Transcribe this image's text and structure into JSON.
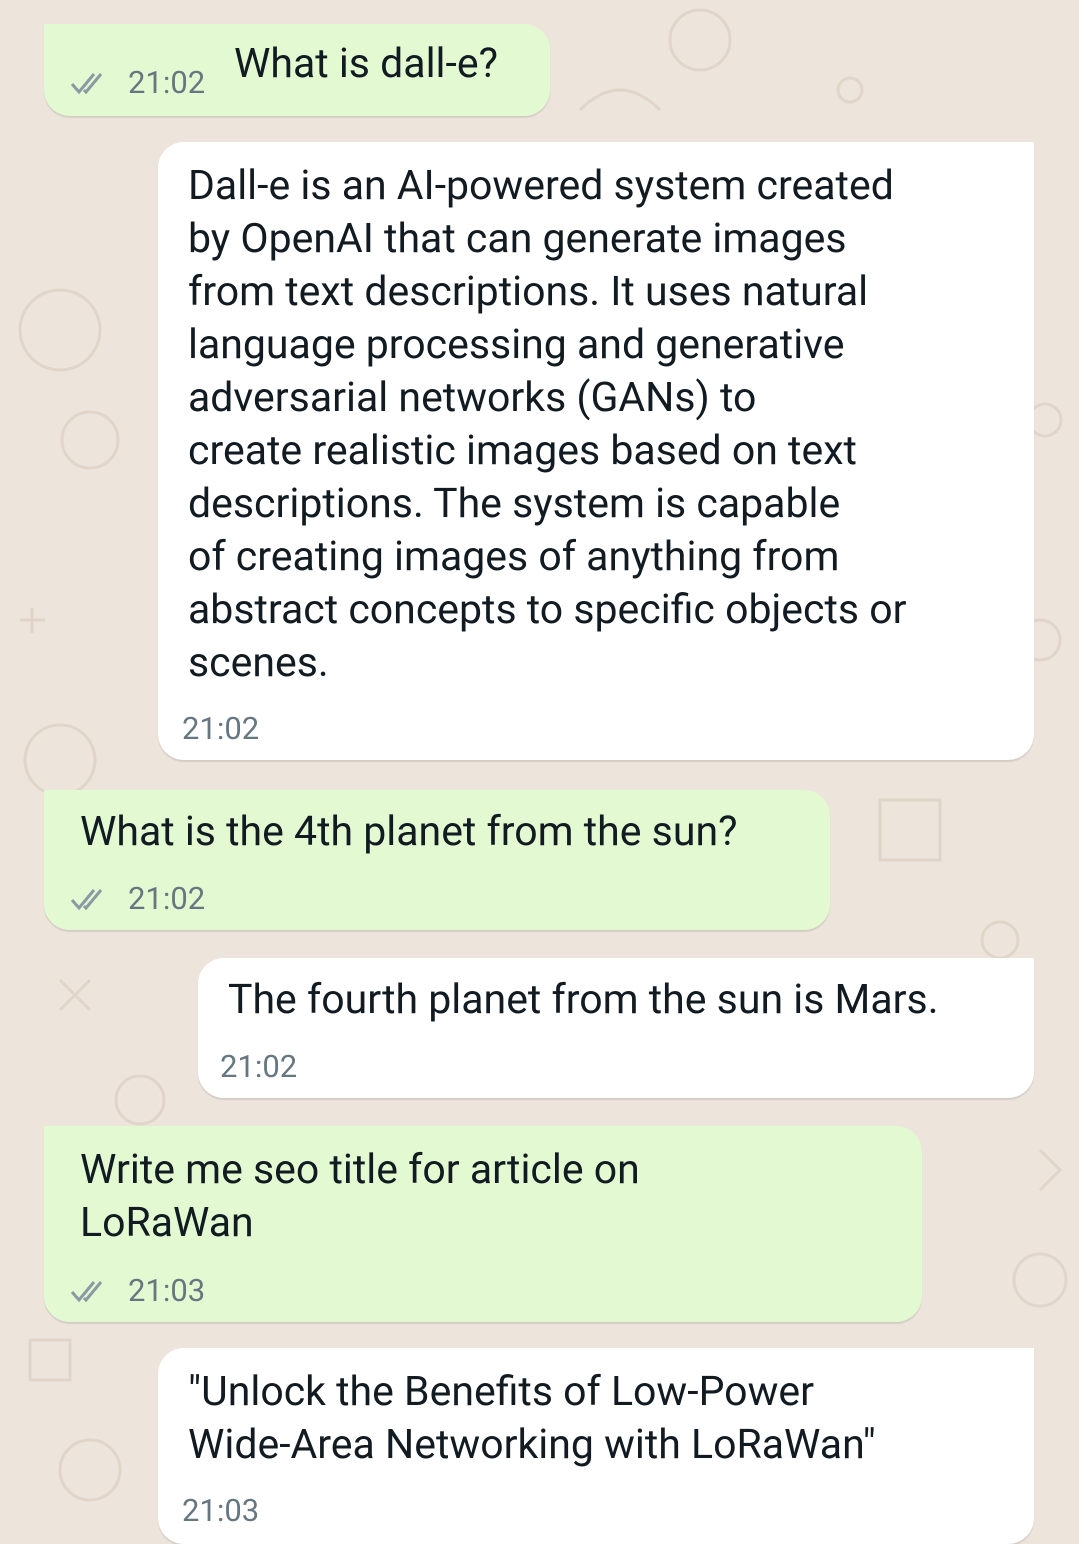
{
  "chat": {
    "messages": [
      {
        "direction": "sent",
        "text": "What is dall-e?",
        "time": "21:02",
        "status_icon": "double-check-icon"
      },
      {
        "direction": "received",
        "text": "Dall-e is an AI-powered system created\nby OpenAI that can generate images\nfrom text descriptions. It uses natural\nlanguage processing and generative\nadversarial networks (GANs) to\ncreate realistic images based on text\ndescriptions. The system is capable\nof creating images of anything from\nabstract concepts to specific objects or\nscenes.",
        "time": "21:02"
      },
      {
        "direction": "sent",
        "text": "What is the 4th planet from the sun?",
        "time": "21:02",
        "status_icon": "double-check-icon"
      },
      {
        "direction": "received",
        "text": "The fourth planet from the sun is Mars.",
        "time": "21:02"
      },
      {
        "direction": "sent",
        "text": "Write me seo title for article on\nLoRaWan",
        "time": "21:03",
        "status_icon": "double-check-icon"
      },
      {
        "direction": "received",
        "text": "\"Unlock the Benefits of Low-Power\nWide-Area Networking with LoRaWan\"",
        "time": "21:03"
      }
    ]
  },
  "colors": {
    "sent_bubble": "#e3f9d2",
    "received_bubble": "#ffffff",
    "background": "#ede5dc",
    "meta_text": "#667781"
  }
}
